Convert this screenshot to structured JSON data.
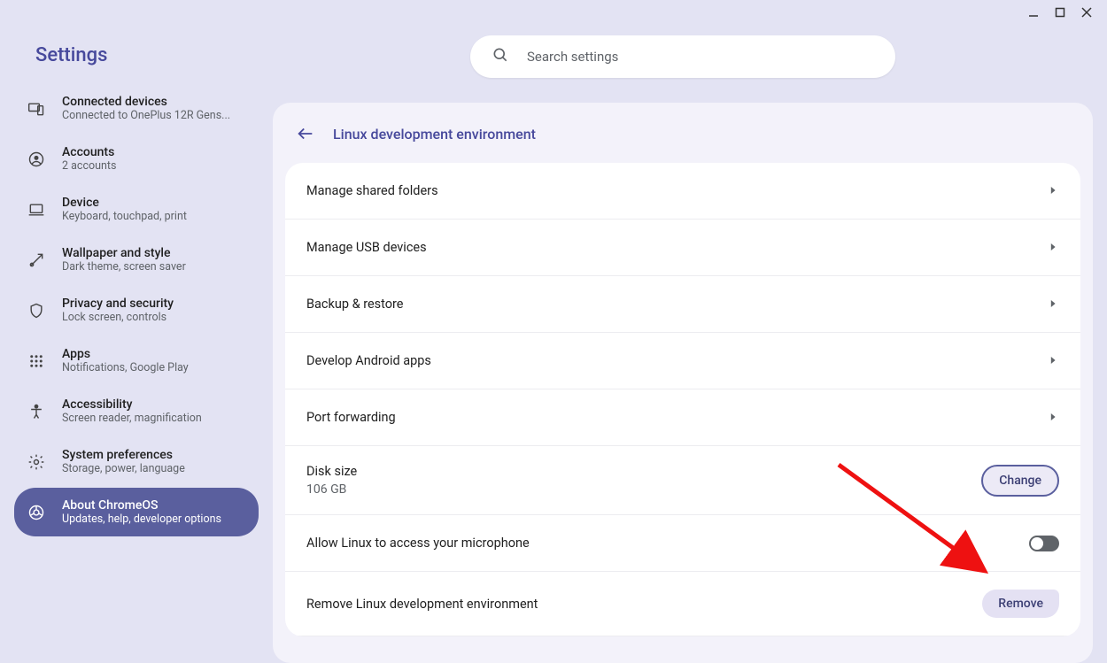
{
  "window": {
    "title": "Settings"
  },
  "search": {
    "placeholder": "Search settings"
  },
  "sidebar": {
    "title": "Settings",
    "items": [
      {
        "label": "Connected devices",
        "sub": "Connected to OnePlus 12R Gens...",
        "icon": "devices-icon"
      },
      {
        "label": "Accounts",
        "sub": "2 accounts",
        "icon": "account-icon"
      },
      {
        "label": "Device",
        "sub": "Keyboard, touchpad, print",
        "icon": "laptop-icon"
      },
      {
        "label": "Wallpaper and style",
        "sub": "Dark theme, screen saver",
        "icon": "palette-icon"
      },
      {
        "label": "Privacy and security",
        "sub": "Lock screen, controls",
        "icon": "shield-icon"
      },
      {
        "label": "Apps",
        "sub": "Notifications, Google Play",
        "icon": "apps-icon"
      },
      {
        "label": "Accessibility",
        "sub": "Screen reader, magnification",
        "icon": "accessibility-icon"
      },
      {
        "label": "System preferences",
        "sub": "Storage, power, language",
        "icon": "gear-icon"
      },
      {
        "label": "About ChromeOS",
        "sub": "Updates, help, developer options",
        "icon": "chrome-icon",
        "active": true
      }
    ]
  },
  "page": {
    "title": "Linux development environment",
    "rows": {
      "manage_folders": "Manage shared folders",
      "manage_usb": "Manage USB devices",
      "backup": "Backup & restore",
      "android": "Develop Android apps",
      "port_fwd": "Port forwarding",
      "disk_label": "Disk size",
      "disk_value": "106 GB",
      "disk_btn": "Change",
      "mic": "Allow Linux to access your microphone",
      "remove_label": "Remove Linux development environment",
      "remove_btn": "Remove"
    }
  }
}
